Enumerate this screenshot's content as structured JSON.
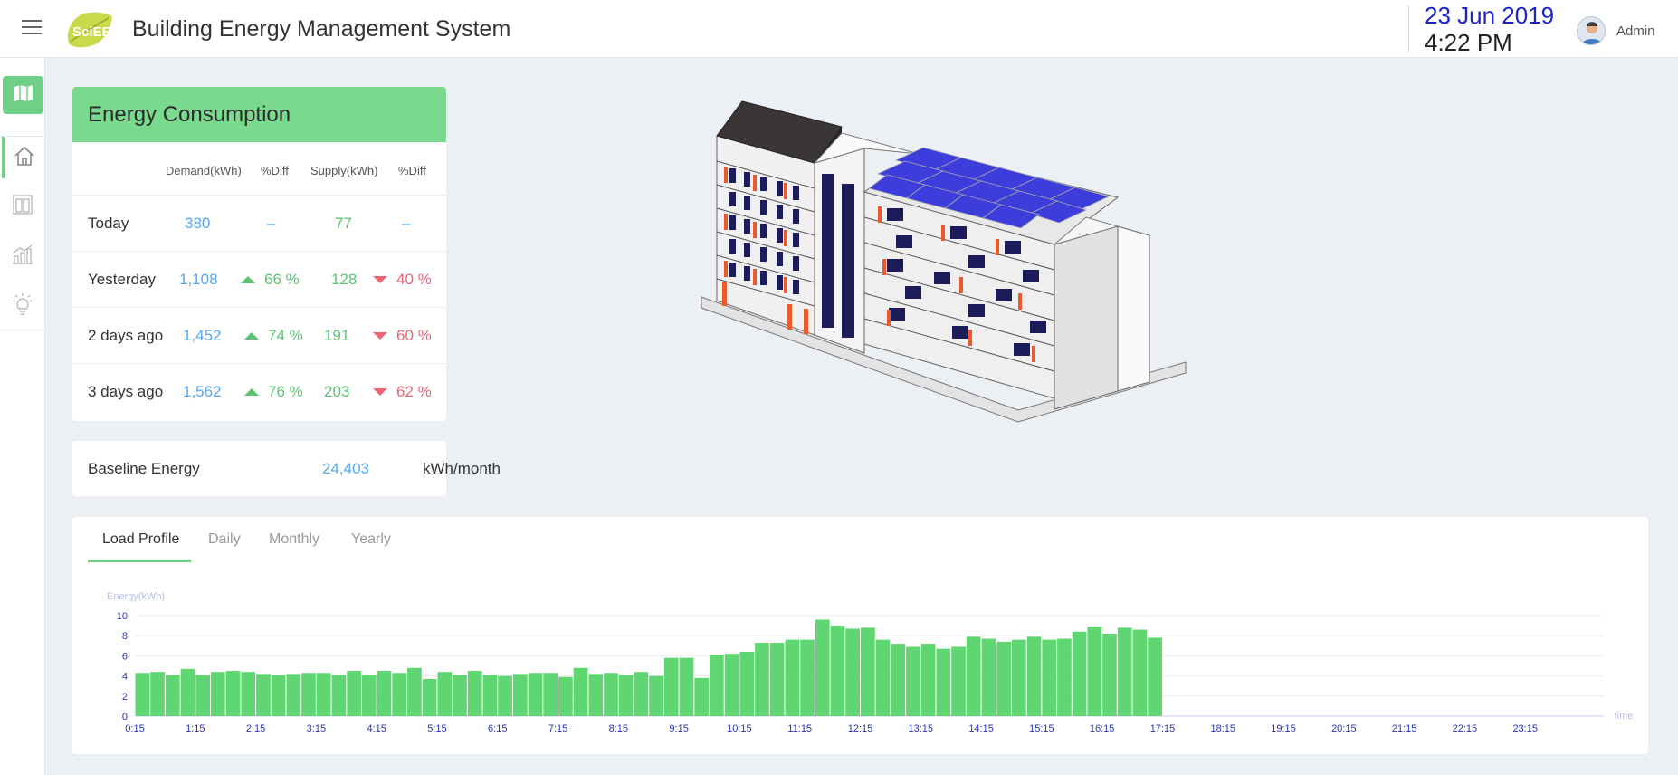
{
  "header": {
    "title": "Building Energy Management System",
    "logo_text": "SciEE",
    "date": "23 Jun 2019",
    "time": "4:22 PM",
    "user": "Admin"
  },
  "sidebar": {
    "items": [
      {
        "name": "map-icon",
        "active": true
      },
      {
        "name": "home-icon",
        "active": false
      },
      {
        "name": "building-icon",
        "active": false
      },
      {
        "name": "analytics-icon",
        "active": false
      },
      {
        "name": "lightbulb-icon",
        "active": false
      }
    ]
  },
  "energy_consumption": {
    "title": "Energy Consumption",
    "columns": [
      "Demand(kWh)",
      "%Diff",
      "Supply(kWh)",
      "%Diff"
    ],
    "rows": [
      {
        "label": "Today",
        "demand": "380",
        "demand_diff": "–",
        "supply": "77",
        "supply_diff": "–"
      },
      {
        "label": "Yesterday",
        "demand": "1,108",
        "demand_diff": "66 %",
        "supply": "128",
        "supply_diff": "40 %"
      },
      {
        "label": "2 days ago",
        "demand": "1,452",
        "demand_diff": "74 %",
        "supply": "191",
        "supply_diff": "60 %"
      },
      {
        "label": "3 days ago",
        "demand": "1,562",
        "demand_diff": "76 %",
        "supply": "203",
        "supply_diff": "62 %"
      }
    ]
  },
  "baseline": {
    "label": "Baseline Energy",
    "value": "24,403",
    "unit": "kWh/month"
  },
  "tabs": [
    {
      "label": "Load Profile",
      "active": true
    },
    {
      "label": "Daily",
      "active": false
    },
    {
      "label": "Monthly",
      "active": false
    },
    {
      "label": "Yearly",
      "active": false
    }
  ],
  "colors": {
    "accent_green": "#6fcf86",
    "demand_blue": "#55a7f0",
    "up_green": "#5cc471",
    "down_red": "#ef6272",
    "date_blue": "#1f22c8",
    "bar_green": "#5fd672"
  },
  "chart_data": {
    "type": "bar",
    "ylabel": "Energy(kWh)",
    "xlabel": "time",
    "ylim": [
      0,
      10
    ],
    "yticks": [
      0,
      2,
      4,
      6,
      8,
      10
    ],
    "xticks": [
      "0:15",
      "1:15",
      "2:15",
      "3:15",
      "4:15",
      "5:15",
      "6:15",
      "7:15",
      "8:15",
      "9:15",
      "10:15",
      "11:15",
      "12:15",
      "13:15",
      "14:15",
      "15:15",
      "16:15",
      "17:15",
      "18:15",
      "19:15",
      "20:15",
      "21:15",
      "22:15",
      "23:15"
    ],
    "slots_per_hour": 4,
    "total_slots": 96,
    "values": [
      4.3,
      4.4,
      4.1,
      4.7,
      4.1,
      4.4,
      4.5,
      4.4,
      4.2,
      4.1,
      4.2,
      4.3,
      4.3,
      4.1,
      4.5,
      4.1,
      4.5,
      4.3,
      4.8,
      3.7,
      4.4,
      4.1,
      4.5,
      4.1,
      4.0,
      4.2,
      4.3,
      4.3,
      3.9,
      4.8,
      4.2,
      4.3,
      4.1,
      4.4,
      4.0,
      5.8,
      5.8,
      3.8,
      6.1,
      6.2,
      6.4,
      7.3,
      7.3,
      7.6,
      7.6,
      9.6,
      9.0,
      8.7,
      8.8,
      7.6,
      7.2,
      6.9,
      7.2,
      6.7,
      6.9,
      7.9,
      7.7,
      7.4,
      7.6,
      7.9,
      7.6,
      7.7,
      8.4,
      8.9,
      8.2,
      8.8,
      8.6,
      7.8
    ],
    "grid": true
  }
}
